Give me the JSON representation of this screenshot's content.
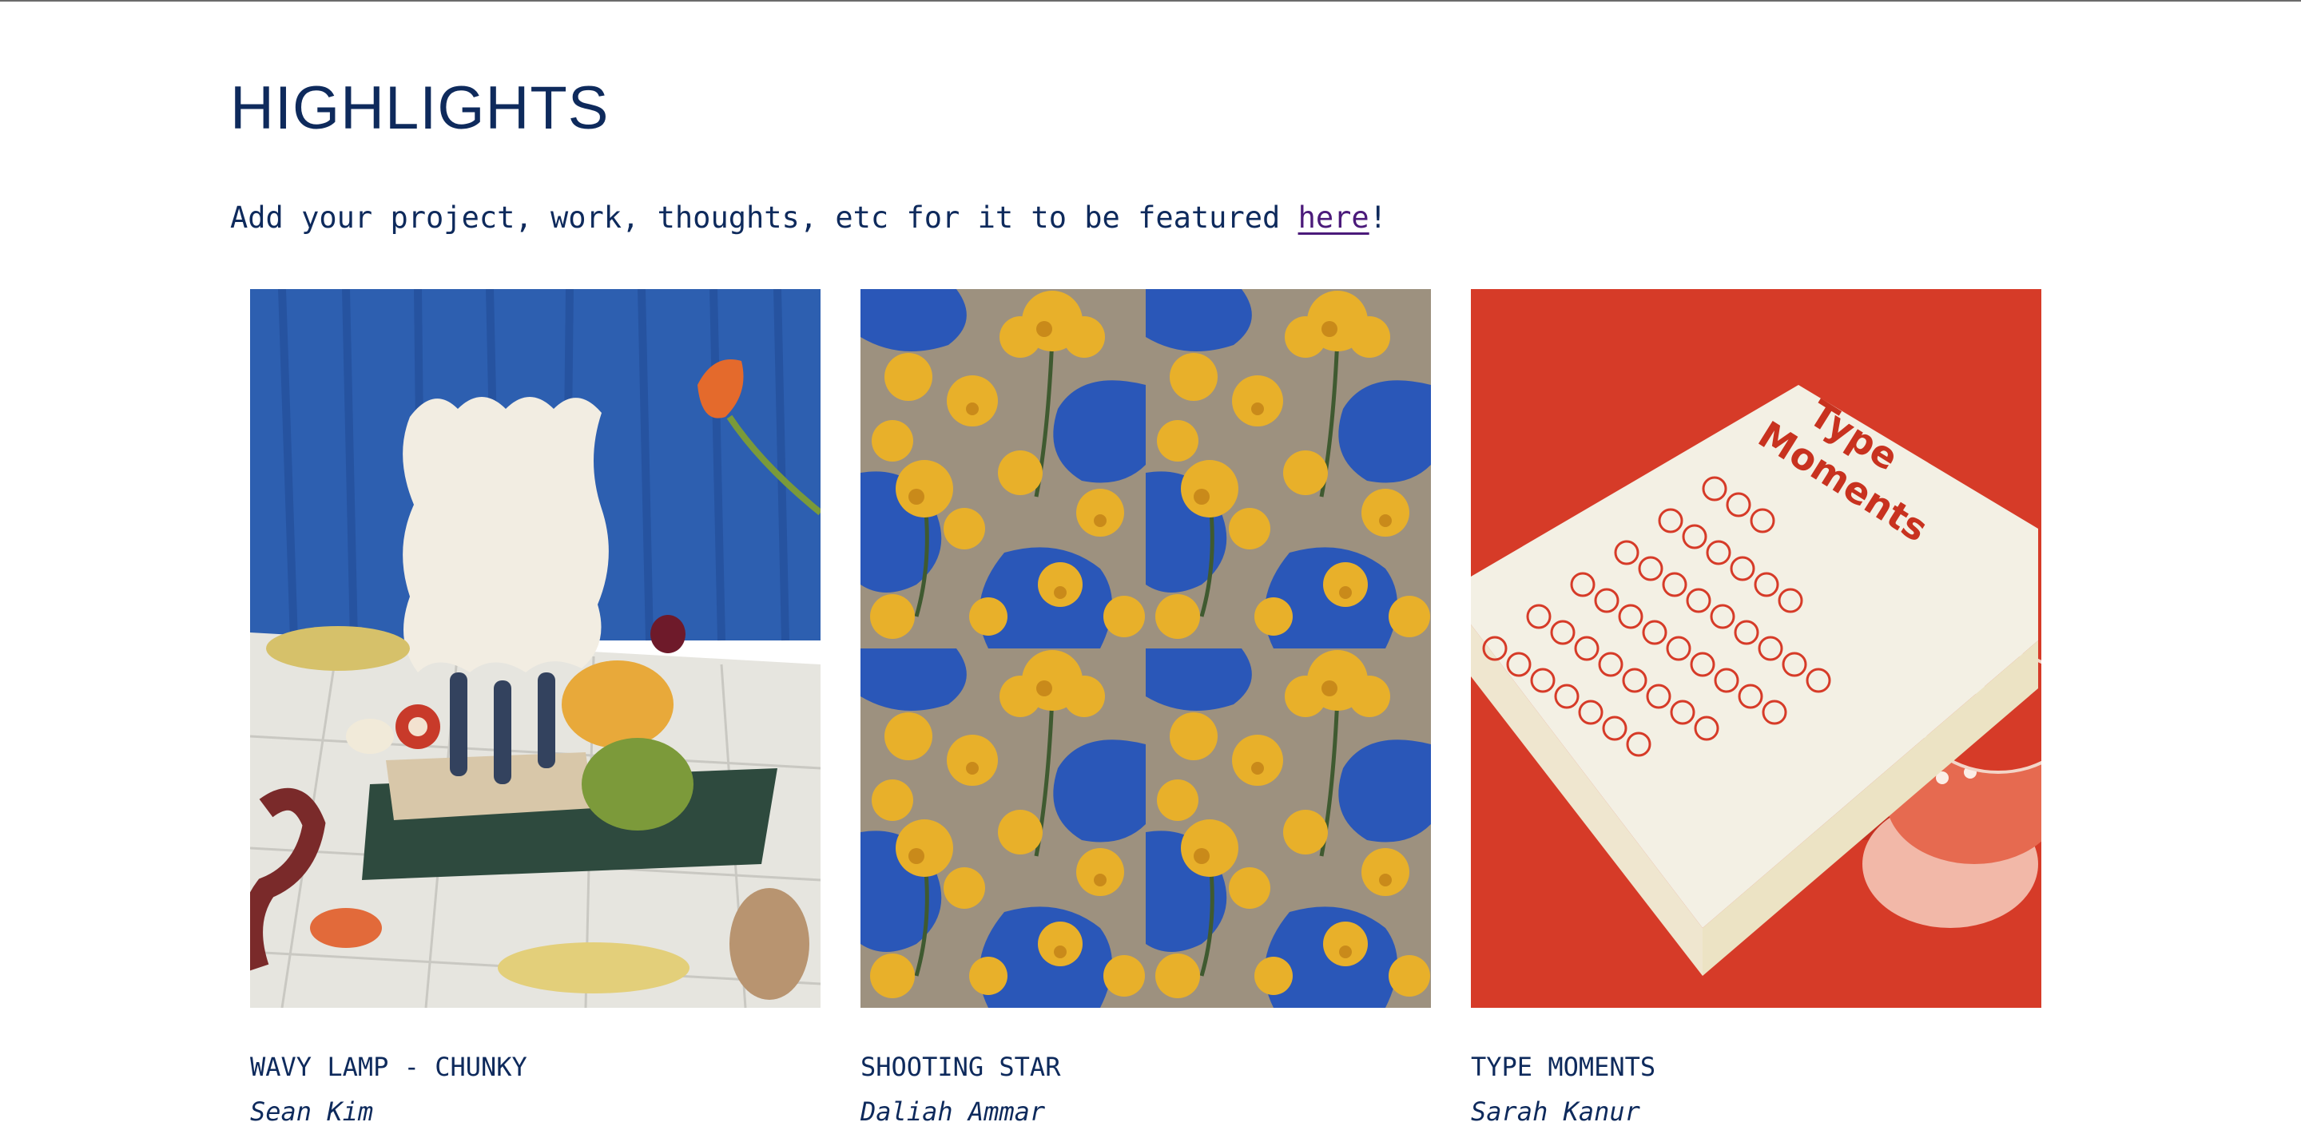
{
  "header": {
    "title": "HIGHLIGHTS"
  },
  "intro": {
    "text_before": "Add your project, work, thoughts, etc for it to be featured ",
    "link_label": "here",
    "text_after": "!"
  },
  "cards": [
    {
      "title": "WAVY LAMP - CHUNKY",
      "author": "Sean Kim",
      "image_icon": "lamp-still-life-image"
    },
    {
      "title": "SHOOTING STAR",
      "author": "Daliah Ammar",
      "image_icon": "floral-pattern-image"
    },
    {
      "title": "TYPE MOMENTS",
      "author": "Sarah Kanur",
      "image_icon": "type-moments-book-image",
      "image_text": "Type Moments"
    }
  ],
  "colors": {
    "heading": "#0e2a5c",
    "link": "#4b1a7a",
    "card3_background": "#d63b28",
    "card2_blue": "#2a57b8",
    "card2_yellow": "#e8b02a"
  }
}
